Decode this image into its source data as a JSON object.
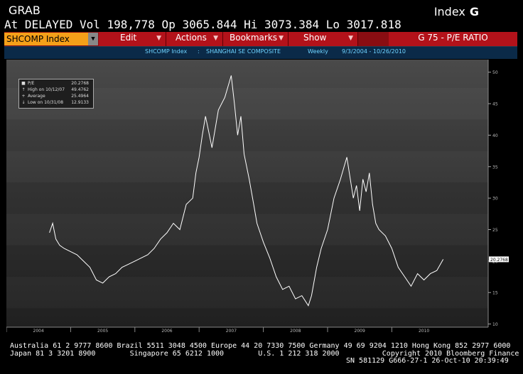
{
  "header": {
    "title": "GRAB",
    "index_label": "Index",
    "index_key": "G",
    "quote": "At DELAYED Vol 198,778 Op 3065.844 Hi 3073.384 Lo 3017.818"
  },
  "menubar": {
    "ticker": "SHCOMP Index",
    "ticker_arrow": "▼",
    "items": [
      {
        "label": "Edit"
      },
      {
        "label": "Actions"
      },
      {
        "label": "Bookmarks"
      },
      {
        "label": "Show"
      }
    ],
    "menu_arrow": "▼",
    "function_label": "G 75 - P/E RATIO"
  },
  "subbar": {
    "security": "SHCOMP Index",
    "separator": ":",
    "name": "SHANGHAI SE COMPOSITE",
    "period": "Weekly",
    "range": "9/3/2004 - 10/26/2010"
  },
  "legend": {
    "rows": [
      {
        "marker": "■",
        "label": "P/E",
        "value": "20.2768"
      },
      {
        "marker": "↑",
        "label": "High on 10/12/07",
        "value": "49.4762"
      },
      {
        "marker": "+",
        "label": "Average",
        "value": "25.4964"
      },
      {
        "marker": "↓",
        "label": "Low on 10/31/08",
        "value": "12.9133"
      }
    ]
  },
  "chart_data": {
    "type": "line",
    "series": [
      {
        "name": "P/E",
        "x": [
          2004.67,
          2004.72,
          2004.77,
          2004.83,
          2004.9,
          2005.0,
          2005.1,
          2005.2,
          2005.3,
          2005.4,
          2005.5,
          2005.6,
          2005.7,
          2005.8,
          2005.9,
          2006.0,
          2006.1,
          2006.2,
          2006.3,
          2006.4,
          2006.5,
          2006.6,
          2006.7,
          2006.8,
          2006.9,
          2006.95,
          2007.0,
          2007.05,
          2007.1,
          2007.15,
          2007.2,
          2007.3,
          2007.4,
          2007.5,
          2007.55,
          2007.6,
          2007.65,
          2007.7,
          2007.78,
          2007.85,
          2007.9,
          2007.95,
          2008.0,
          2008.1,
          2008.2,
          2008.3,
          2008.4,
          2008.5,
          2008.6,
          2008.7,
          2008.75,
          2008.83,
          2008.9,
          2009.0,
          2009.1,
          2009.2,
          2009.3,
          2009.4,
          2009.45,
          2009.5,
          2009.55,
          2009.6,
          2009.65,
          2009.7,
          2009.75,
          2009.8,
          2009.9,
          2010.0,
          2010.1,
          2010.2,
          2010.3,
          2010.4,
          2010.5,
          2010.6,
          2010.7,
          2010.8
        ],
        "values": [
          24.5,
          26.0,
          23.5,
          22.5,
          22.0,
          21.5,
          21.0,
          20.0,
          19.0,
          17.0,
          16.5,
          17.5,
          18.0,
          19.0,
          19.5,
          20.0,
          20.5,
          21.0,
          22.0,
          23.5,
          24.5,
          26.0,
          25.0,
          29.0,
          30.0,
          34.0,
          36.5,
          40.0,
          43.0,
          40.5,
          38.0,
          44.0,
          46.0,
          49.4762,
          45.0,
          40.0,
          43.0,
          37.0,
          33.0,
          29.0,
          26.0,
          24.5,
          23.0,
          20.5,
          17.5,
          15.5,
          16.0,
          14.0,
          14.5,
          12.9133,
          14.5,
          19.0,
          22.0,
          25.0,
          30.0,
          33.0,
          36.5,
          30.0,
          32.0,
          28.0,
          33.0,
          31.0,
          34.0,
          29.0,
          26.0,
          25.0,
          24.0,
          22.0,
          19.0,
          17.5,
          16.0,
          18.0,
          17.0,
          18.0,
          18.5,
          20.2768
        ]
      }
    ],
    "xlabels": [
      "2004",
      "2005",
      "2006",
      "2007",
      "2008",
      "2009",
      "2010"
    ],
    "yticks": [
      10,
      15,
      20,
      25,
      30,
      35,
      40,
      45,
      50
    ],
    "ylim": [
      9.5,
      52
    ],
    "last_label": "20.2768",
    "legend_position": "top-left",
    "grid": false
  },
  "footer": {
    "line1": "Australia 61 2 9777 8600 Brazil 5511 3048 4500 Europe 44 20 7330 7500 Germany 49 69 9204 1210 Hong Kong 852 2977 6000",
    "line2": "Japan 81 3 3201 8900        Singapore 65 6212 1000        U.S. 1 212 318 2000          Copyright 2010 Bloomberg Finance L.P.",
    "line3": "SN 581129 G666-27-1 26-Oct-10 20:39:49"
  },
  "colors": {
    "accent": "#b3121a",
    "ticker_bg": "#f5a019",
    "subbar_text": "#6fd3ff",
    "line": "#ffffff"
  }
}
